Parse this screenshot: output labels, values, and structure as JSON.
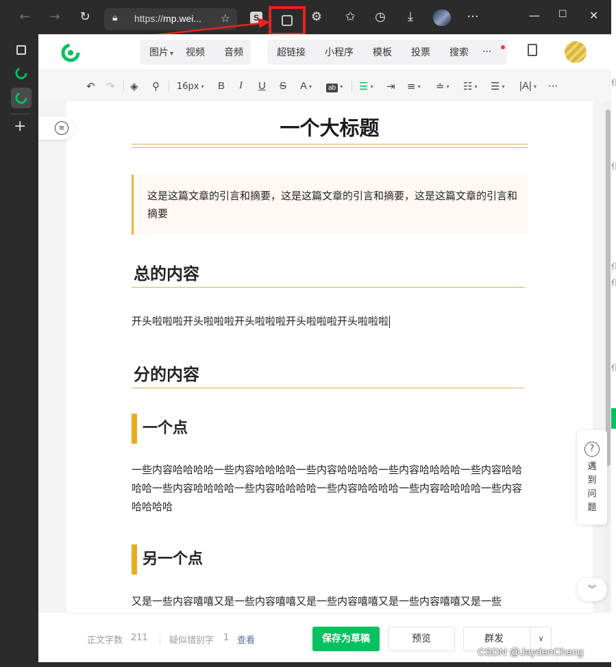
{
  "browser": {
    "url_prefix": "https://",
    "url_host": "mp.wei...",
    "extension_s_label": "S"
  },
  "editor_menu": {
    "group1": [
      "图片",
      "视频",
      "音频"
    ],
    "group2": [
      "超链接",
      "小程序",
      "模板",
      "投票",
      "搜索"
    ],
    "more_label": "···"
  },
  "toolbar": {
    "font_size": "16px",
    "bold": "B",
    "italic": "I",
    "underline": "U",
    "strike": "S",
    "font_color": "A",
    "bg_color": "ab",
    "letter_spacing": "|A|",
    "more": "···"
  },
  "article": {
    "title": "一个大标题",
    "quote": "这是这篇文章的引言和摘要，这是这篇文章的引言和摘要，这是这篇文章的引言和摘要",
    "section1_heading": "总的内容",
    "section1_body": "开头啦啦啦开头啦啦啦开头啦啦啦开头啦啦啦开头啦啦啦",
    "section2_heading": "分的内容",
    "point1_heading": "一个点",
    "point1_body": "一些内容哈哈哈哈一些内容哈哈哈哈一些内容哈哈哈哈一些内容哈哈哈哈一些内容哈哈哈哈一些内容哈哈哈哈一些内容哈哈哈哈一些内容哈哈哈哈一些内容哈哈哈哈一些内容哈哈哈哈",
    "point2_heading": "另一个点",
    "point2_body": "又是一些内容嘻嘻又是一些内容嘻嘻又是一些内容嘻嘻又是一些内容嘻嘻又是一些"
  },
  "help": {
    "icon_label": "?",
    "text": "遇到问题"
  },
  "footer": {
    "word_count_label": "正文字数",
    "word_count": "211",
    "typo_label": "疑似错别字",
    "typo_count": "1",
    "view_link": "查看",
    "save_draft": "保存为草稿",
    "preview": "预览",
    "mass_send": "群发"
  },
  "watermark": "CSDN @JaydenCheng",
  "colors": {
    "brand_green": "#07c160",
    "highlight_red": "#e8231f",
    "accent_gold": "#e9ad1b"
  }
}
